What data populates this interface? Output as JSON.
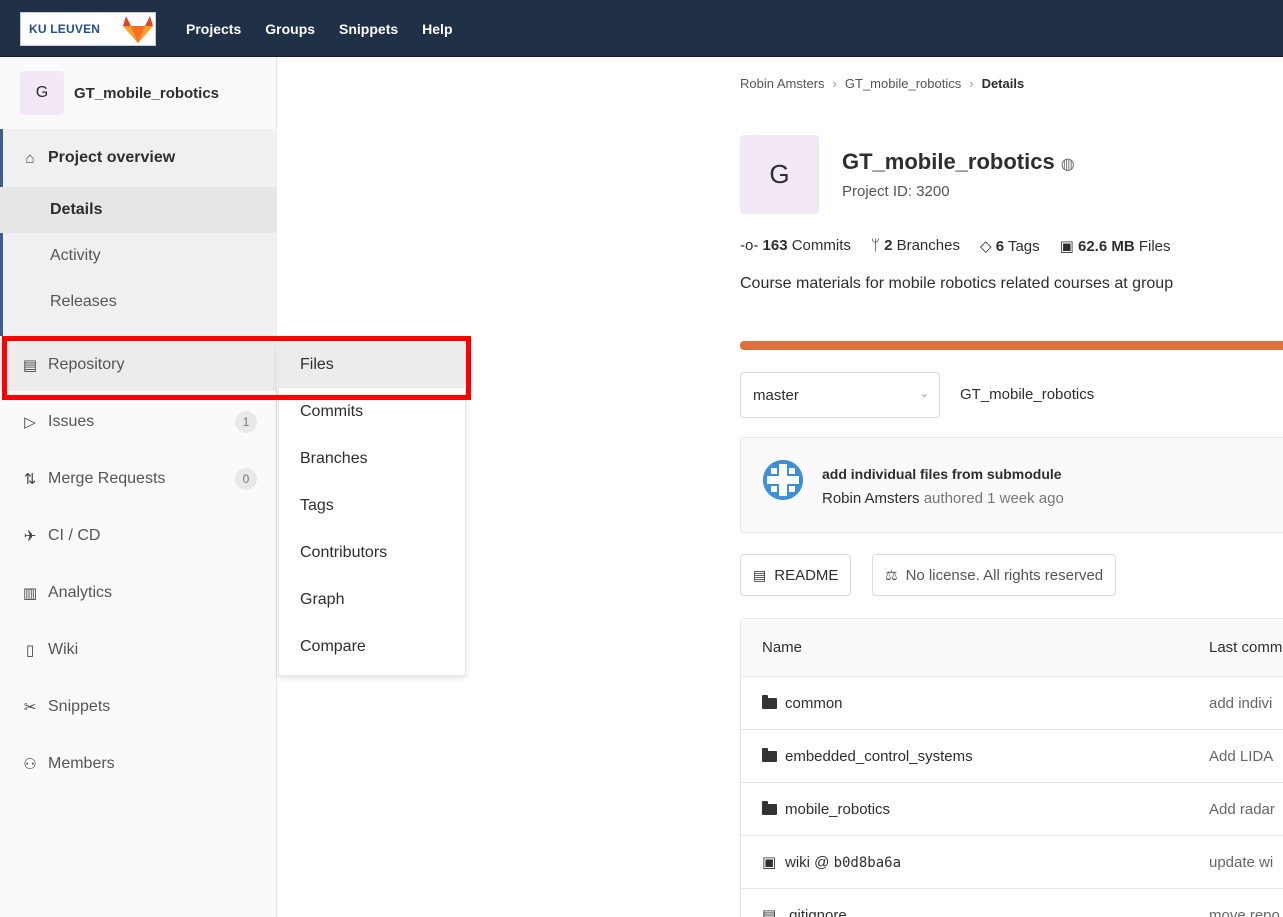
{
  "navbar": {
    "logo_text": "KU LEUVEN",
    "links": [
      "Projects",
      "Groups",
      "Snippets",
      "Help"
    ]
  },
  "sidebar": {
    "avatar_letter": "G",
    "project_name": "GT_mobile_robotics",
    "overview_label": "Project overview",
    "overview_subitems": [
      "Details",
      "Activity",
      "Releases"
    ],
    "items": [
      {
        "label": "Repository",
        "icon": "document-icon"
      },
      {
        "label": "Issues",
        "icon": "issues-icon",
        "count": "1"
      },
      {
        "label": "Merge Requests",
        "icon": "merge-request-icon",
        "count": "0"
      },
      {
        "label": "CI / CD",
        "icon": "rocket-icon"
      },
      {
        "label": "Analytics",
        "icon": "chart-icon"
      },
      {
        "label": "Wiki",
        "icon": "book-icon"
      },
      {
        "label": "Snippets",
        "icon": "scissors-icon"
      },
      {
        "label": "Members",
        "icon": "users-icon"
      }
    ]
  },
  "flyout": {
    "items": [
      "Files",
      "Commits",
      "Branches",
      "Tags",
      "Contributors",
      "Graph",
      "Compare"
    ]
  },
  "main": {
    "breadcrumb": [
      "Robin Amsters",
      "GT_mobile_robotics",
      "Details"
    ],
    "avatar_letter": "G",
    "project_title": "GT_mobile_robotics",
    "project_id": "Project ID: 3200",
    "stats": {
      "commits_count": "163",
      "commits_label": "Commits",
      "branches_count": "2",
      "branches_label": "Branches",
      "tags_count": "6",
      "tags_label": "Tags",
      "files_size": "62.6 MB",
      "files_label": "Files"
    },
    "description": "Course materials for mobile robotics related courses at group",
    "language_bar_color": "#e0713f",
    "branch": "master",
    "repo_path": "GT_mobile_robotics",
    "last_commit": {
      "title": "add individual files from submodule",
      "author": "Robin Amsters",
      "meta": "authored 1 week ago"
    },
    "readme_button": "README",
    "license_button": "No license. All rights reserved",
    "table": {
      "header_name": "Name",
      "header_commit": "Last comm",
      "rows": [
        {
          "name": "common",
          "type": "folder",
          "commit": "add indivi"
        },
        {
          "name": "embedded_control_systems",
          "type": "folder",
          "commit": "Add LIDA"
        },
        {
          "name": "mobile_robotics",
          "type": "folder",
          "commit": "Add radar"
        },
        {
          "name_prefix": "wiki @ ",
          "name_hash": "b0d8ba6a",
          "type": "submodule",
          "commit": "update wi"
        },
        {
          "name": ".gitignore",
          "type": "file",
          "commit": "move repo"
        }
      ]
    }
  }
}
